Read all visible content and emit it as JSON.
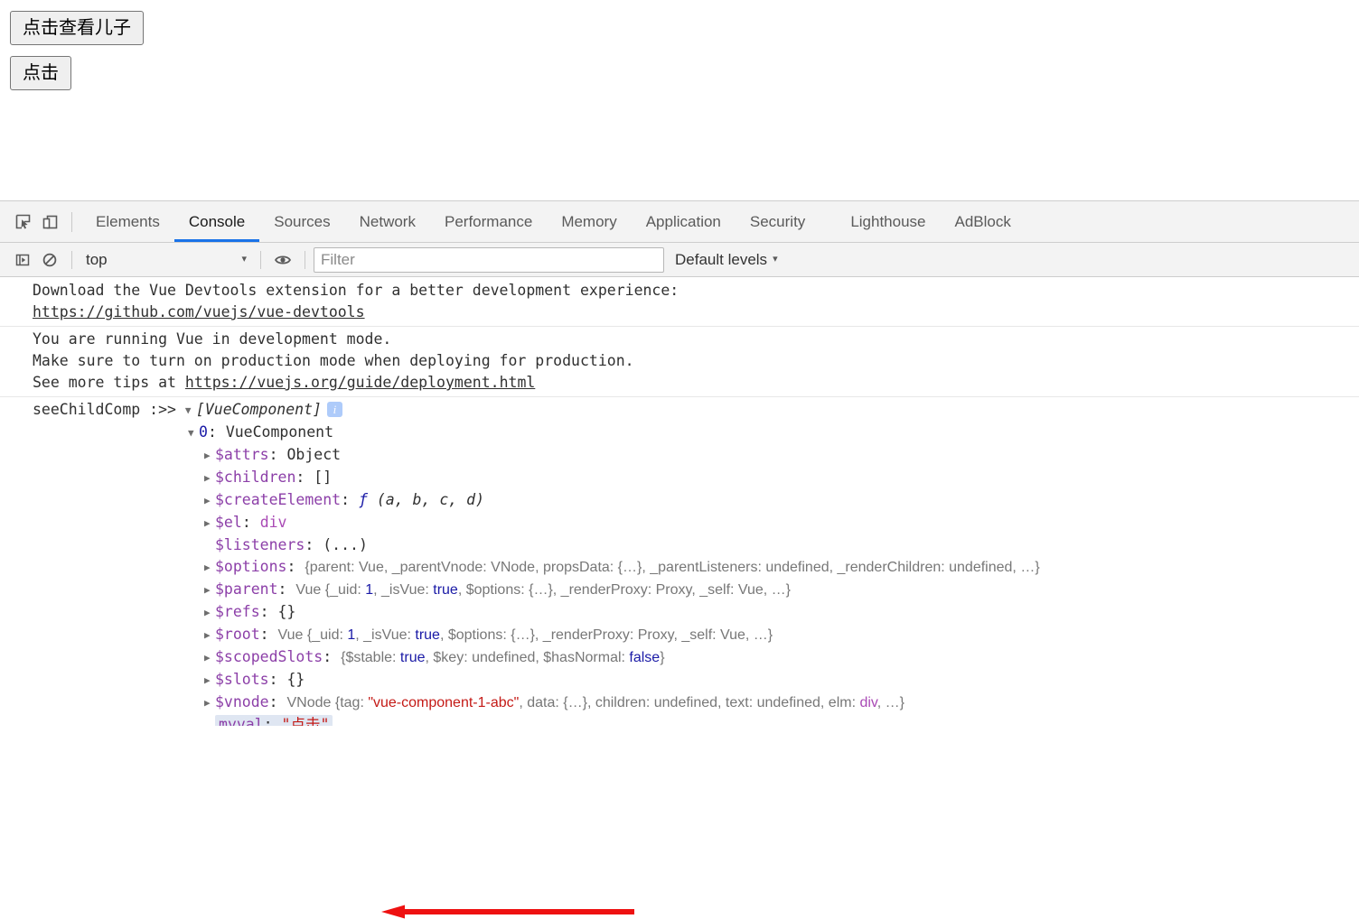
{
  "page": {
    "buttons": [
      {
        "label": "点击查看儿子",
        "name": "see-child-button"
      },
      {
        "label": "点击",
        "name": "click-button"
      }
    ]
  },
  "devtools": {
    "tabs": [
      {
        "label": "Elements",
        "active": false
      },
      {
        "label": "Console",
        "active": true
      },
      {
        "label": "Sources",
        "active": false
      },
      {
        "label": "Network",
        "active": false
      },
      {
        "label": "Performance",
        "active": false
      },
      {
        "label": "Memory",
        "active": false
      },
      {
        "label": "Application",
        "active": false
      },
      {
        "label": "Security",
        "active": false
      },
      {
        "label": "Lighthouse",
        "active": false
      },
      {
        "label": "AdBlock",
        "active": false
      }
    ],
    "toolbar": {
      "inspect_icon": "inspect-element-icon",
      "device_icon": "device-toolbar-icon"
    },
    "filterbar": {
      "sidebar_icon": "show-console-sidebar-icon",
      "clear_icon": "clear-console-icon",
      "context": "top",
      "context_caret": "▾",
      "eye_icon": "live-expression-eye-icon",
      "filter_placeholder": "Filter",
      "filter_value": "",
      "levels_label": "Default levels",
      "levels_caret": "▾"
    }
  },
  "console": {
    "messages": [
      {
        "text_before": "Download the Vue Devtools extension for a better development experience:\n",
        "link": "https://github.com/vuejs/vue-devtools",
        "text_after": ""
      },
      {
        "text_before": "You are running Vue in development mode.\nMake sure to turn on production mode when deploying for production.\nSee more tips at ",
        "link": "https://vuejs.org/guide/deployment.html",
        "text_after": ""
      }
    ],
    "entry": {
      "label": "seeChildComp :>>",
      "array_preview": "[VueComponent]",
      "info_badge": "i",
      "index_key": "0",
      "index_value": "VueComponent",
      "properties": [
        {
          "key": "$attrs",
          "sep": ": ",
          "value": "Object",
          "value_class": "plain",
          "expandable": true
        },
        {
          "key": "$children",
          "sep": ": ",
          "value": "[]",
          "value_class": "plain",
          "expandable": true
        },
        {
          "key": "$createElement",
          "sep": ": ",
          "value": "ƒ (a, b, c, d)",
          "value_class": "function",
          "expandable": true
        },
        {
          "key": "$el",
          "sep": ": ",
          "value": "div",
          "value_class": "node",
          "expandable": true
        },
        {
          "key": "$listeners",
          "sep": ": ",
          "value": "(...)",
          "value_class": "plain",
          "expandable": false
        },
        {
          "key": "$options",
          "sep": ": ",
          "value": "{parent: Vue, _parentVnode: VNode, propsData: {…}, _parentListeners: undefined, _renderChildren: undefined, …}",
          "value_class": "gray",
          "expandable": true
        },
        {
          "key": "$parent",
          "sep": ": ",
          "value": "Vue {_uid: 1, _isVue: true, $options: {…}, _renderProxy: Proxy, _self: Vue, …}",
          "value_class": "gray",
          "expandable": true
        },
        {
          "key": "$refs",
          "sep": ": ",
          "value": "{}",
          "value_class": "plain",
          "expandable": true
        },
        {
          "key": "$root",
          "sep": ": ",
          "value": "Vue {_uid: 1, _isVue: true, $options: {…}, _renderProxy: Proxy, _self: Vue, …}",
          "value_class": "gray",
          "expandable": true
        },
        {
          "key": "$scopedSlots",
          "sep": ": ",
          "value": "{$stable: true, $key: undefined, $hasNormal: false}",
          "value_class": "gray",
          "expandable": true
        },
        {
          "key": "$slots",
          "sep": ": ",
          "value": "{}",
          "value_class": "plain",
          "expandable": true
        },
        {
          "key": "$vnode",
          "sep": ": ",
          "value": "VNode {tag: \"vue-component-1-abc\", data: {…}, children: undefined, text: undefined, elm: div, …}",
          "value_class": "gray",
          "expandable": true
        },
        {
          "key": "myval",
          "sep": ": ",
          "value": "\"点击\"",
          "value_class": "str",
          "expandable": false,
          "highlighted": true
        }
      ]
    }
  },
  "annotation": {
    "arrow_color": "#ee1111",
    "arrow_name": "red-pointer-arrow"
  }
}
